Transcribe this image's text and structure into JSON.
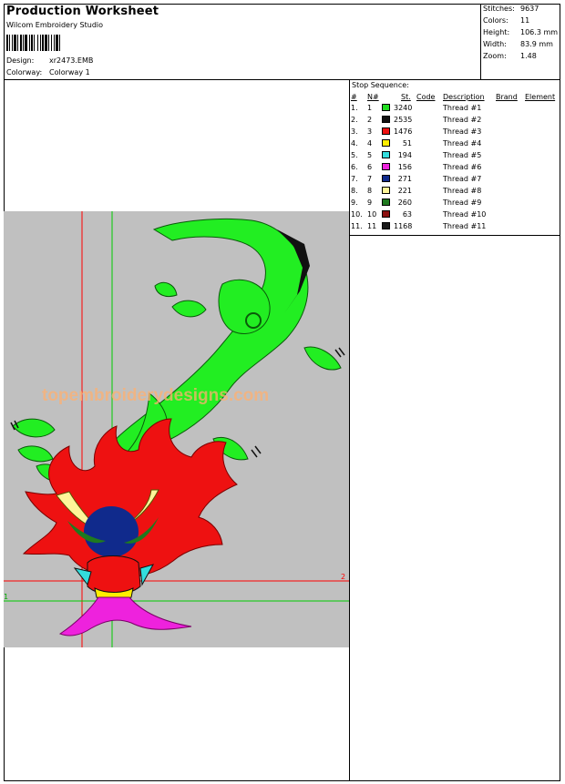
{
  "header": {
    "title": "Production Worksheet",
    "software": "Wilcom Embroidery Studio",
    "design_label": "Design:",
    "design_value": "xr2473.EMB",
    "colorway_label": "Colorway:",
    "colorway_value": "Colorway 1"
  },
  "stats": [
    {
      "label": "Stitches:",
      "value": "9637"
    },
    {
      "label": "Colors:",
      "value": "11"
    },
    {
      "label": "Height:",
      "value": "106.3 mm"
    },
    {
      "label": "Width:",
      "value": "83.9 mm"
    },
    {
      "label": "Zoom:",
      "value": "1.48"
    }
  ],
  "sequence": {
    "title": "Stop Sequence:",
    "columns": [
      "#",
      "N#",
      "St.",
      "Code",
      "Description",
      "Brand",
      "Element"
    ],
    "rows": [
      {
        "idx": "1.",
        "n": "1",
        "color": "#22dd22",
        "st": "3240",
        "desc": "Thread #1"
      },
      {
        "idx": "2.",
        "n": "2",
        "color": "#111111",
        "st": "2535",
        "desc": "Thread #2"
      },
      {
        "idx": "3.",
        "n": "3",
        "color": "#ee1111",
        "st": "1476",
        "desc": "Thread #3"
      },
      {
        "idx": "4.",
        "n": "4",
        "color": "#ffee00",
        "st": "51",
        "desc": "Thread #4"
      },
      {
        "idx": "5.",
        "n": "5",
        "color": "#33dddd",
        "st": "194",
        "desc": "Thread #5"
      },
      {
        "idx": "6.",
        "n": "6",
        "color": "#ee22dd",
        "st": "156",
        "desc": "Thread #6"
      },
      {
        "idx": "7.",
        "n": "7",
        "color": "#102a8c",
        "st": "271",
        "desc": "Thread #7"
      },
      {
        "idx": "8.",
        "n": "8",
        "color": "#fff599",
        "st": "221",
        "desc": "Thread #8"
      },
      {
        "idx": "9.",
        "n": "9",
        "color": "#1f7a1f",
        "st": "260",
        "desc": "Thread #9"
      },
      {
        "idx": "10.",
        "n": "10",
        "color": "#8b1010",
        "st": "63",
        "desc": "Thread #10"
      },
      {
        "idx": "11.",
        "n": "11",
        "color": "#1a1a1a",
        "st": "1168",
        "desc": "Thread #11"
      }
    ]
  },
  "canvas": {
    "marker_x": "1",
    "marker_y": "2",
    "watermark": "topembroiderydesigns.com"
  }
}
